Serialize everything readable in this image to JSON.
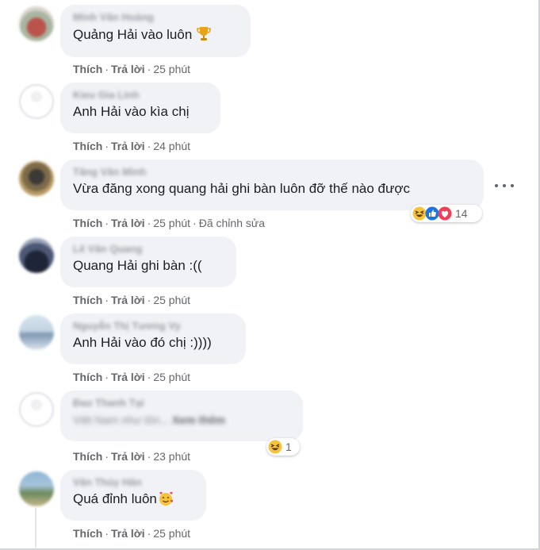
{
  "actions": {
    "like": "Thích",
    "reply": "Trả lời",
    "sep": "·"
  },
  "colors": {
    "bubble": "#f0f2f5",
    "meta": "#65676b",
    "text": "#1c1e21"
  },
  "comments": [
    {
      "name": "Minh Văn Hoàng",
      "text": "Quảng Hải vào luôn",
      "time": "25 phút",
      "icon": "trophy-icon"
    },
    {
      "name": "Kieu Gia Linh",
      "text": "Anh Hải vào kìa chị",
      "time": "24 phút"
    },
    {
      "name": "Tăng Văn Minh",
      "text": "Vừa đăng xong quang hải ghi bàn luôn đỡ thế nào được",
      "time": "25 phút",
      "edited": "Đã chỉnh sửa",
      "reaction_count": "14",
      "reaction_icons": [
        "haha-icon",
        "like-icon",
        "love-icon"
      ]
    },
    {
      "name": "Lê Văn Quang",
      "text": "Quang Hải ghi bàn :((",
      "time": "25 phút"
    },
    {
      "name": "Nguyễn Thị Tương Vy",
      "text": "Anh Hải vào đó chị :))))",
      "time": "25 phút"
    },
    {
      "name": "Đao Thanh Tại",
      "text": "Việt Nam như tôn...",
      "see_more": "Xem thêm",
      "time": "23 phút",
      "reaction_count": "1",
      "reaction_icons": [
        "haha-icon"
      ]
    },
    {
      "name": "Văn Thúy Hân",
      "text": "Quá đỉnh luôn",
      "time": "25 phút",
      "icon": "smiling-hearts-icon"
    }
  ]
}
